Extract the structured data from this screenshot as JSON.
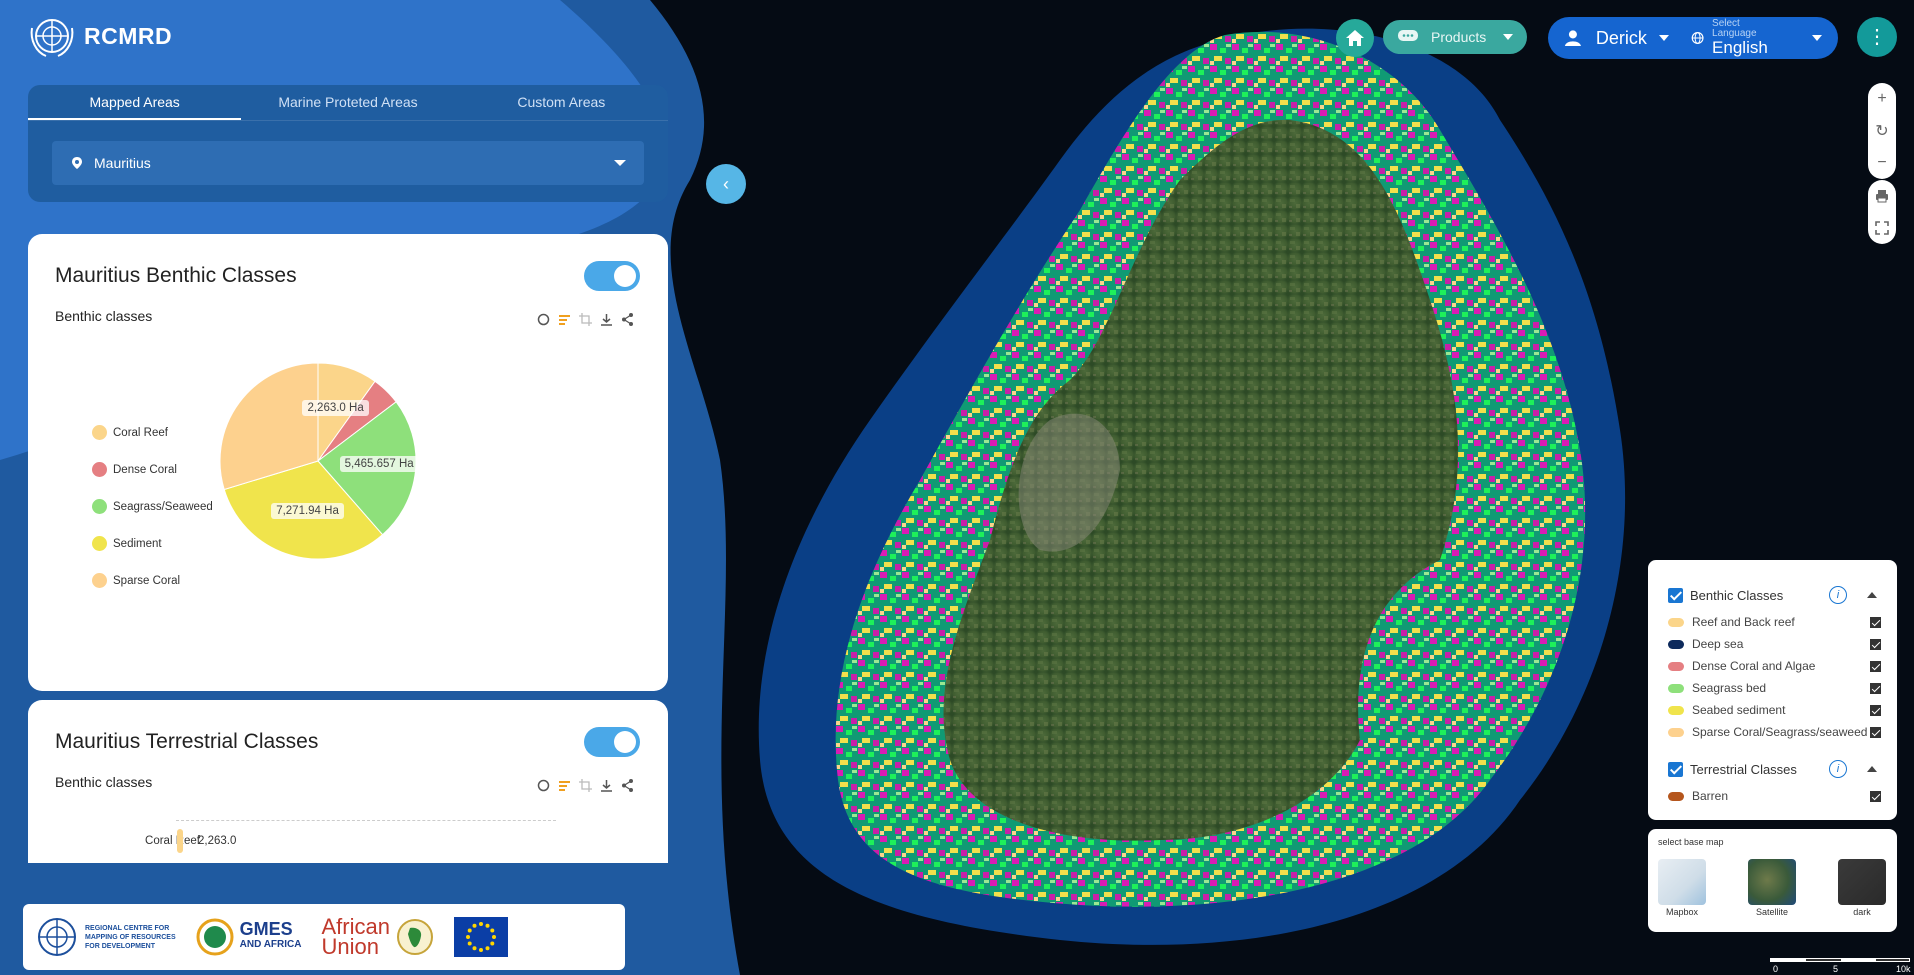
{
  "app": {
    "logo_text": "RCMRD"
  },
  "tabs": [
    {
      "label": "Mapped Areas",
      "active": true
    },
    {
      "label": "Marine Proteted Areas",
      "active": false
    },
    {
      "label": "Custom Areas",
      "active": false
    }
  ],
  "area_select": {
    "value": "Mauritius"
  },
  "card1": {
    "title": "Mauritius Benthic Classes",
    "subtitle": "Benthic classes",
    "toggle_on": true
  },
  "chart_data": [
    {
      "type": "pie",
      "title": "Benthic classes",
      "legend": [
        "Coral Reef",
        "Dense Coral",
        "Seagrass/Seaweed",
        "Sediment",
        "Sparse Coral"
      ],
      "colors": [
        "#fbd58a",
        "#e57f82",
        "#8ee07b",
        "#f0e44c",
        "#fdd18e"
      ],
      "values": [
        2263.0,
        1100,
        5465.657,
        7271.94,
        6800
      ],
      "data_labels": [
        "2,263.0 Ha",
        "",
        "5,465.657 Ha",
        "7,271.94 Ha",
        ""
      ]
    },
    {
      "type": "bar",
      "title": "Benthic classes",
      "categories": [
        "Coral Reef"
      ],
      "values": [
        2263.0
      ],
      "data_labels": [
        "2,263.0"
      ]
    }
  ],
  "card2": {
    "title": "Mauritius Terrestrial Classes",
    "subtitle": "Benthic classes",
    "toggle_on": true
  },
  "footer_logos": {
    "rcmrd_line1": "REGIONAL CENTRE FOR",
    "rcmrd_line2": "MAPPING OF RESOURCES",
    "rcmrd_line3": "FOR DEVELOPMENT",
    "gmes_1": "GMES",
    "gmes_2": "AND AFRICA",
    "au_1": "African",
    "au_2": "Union"
  },
  "nav": {
    "products_label": "Products",
    "user_name": "Derick",
    "lang_hint": "Select Language",
    "lang_value": "English"
  },
  "layers": {
    "benthic_group": "Benthic Classes",
    "benthic_items": [
      {
        "label": "Reef and Back reef",
        "color": "#fbd58a"
      },
      {
        "label": "Deep sea",
        "color": "#0d2a5c"
      },
      {
        "label": "Dense Coral and Algae",
        "color": "#e57f82"
      },
      {
        "label": "Seagrass bed",
        "color": "#8ee07b"
      },
      {
        "label": "Seabed sediment",
        "color": "#f0e44c"
      },
      {
        "label": "Sparse Coral/Seagrass/seaweed",
        "color": "#fdd18e"
      }
    ],
    "terrestrial_group": "Terrestrial Classes",
    "terrestrial_items": [
      {
        "label": "Barren",
        "color": "#b5561d"
      }
    ]
  },
  "basemap": {
    "title": "select base map",
    "options": [
      "Mapbox",
      "Satellite",
      "dark"
    ]
  },
  "scale": {
    "labels": [
      "0",
      "5",
      "10k"
    ]
  }
}
